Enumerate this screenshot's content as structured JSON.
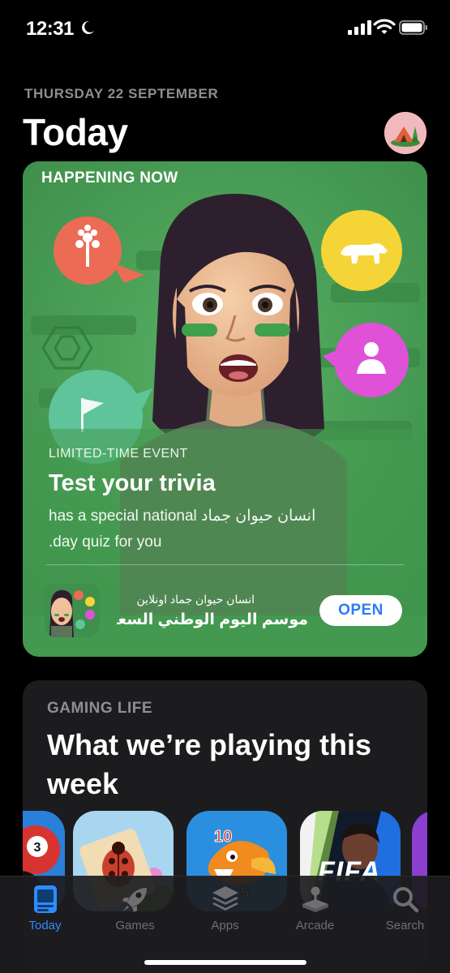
{
  "status_bar": {
    "time": "12:31"
  },
  "header": {
    "date": "THURSDAY 22 SEPTEMBER",
    "title": "Today"
  },
  "featured": {
    "kicker": "HAPPENING NOW",
    "event_kicker": "LIMITED-TIME EVENT",
    "event_title": "Test your trivia",
    "event_desc_line1": "انسان حيوان جماد has a special national",
    "event_desc_line2": "day quiz for you.",
    "app_subtitle": "انسان حيوان جماد اونلاين",
    "app_name": "موسم اليوم الوطني السعودي",
    "open_label": "OPEN",
    "accent": "#43994f"
  },
  "gaming": {
    "kicker": "GAMING LIFE",
    "title": "What we’re playing this week",
    "game_icons": [
      "8-ball-icon",
      "ladybug-icon",
      "fish-game-icon",
      "fifa-icon",
      "purple-game-icon"
    ],
    "fifa_text": "FIFA"
  },
  "tabbar": {
    "tabs": [
      {
        "label": "Today",
        "icon": "today-icon",
        "active": true
      },
      {
        "label": "Games",
        "icon": "rocket-icon",
        "active": false
      },
      {
        "label": "Apps",
        "icon": "apps-stack-icon",
        "active": false
      },
      {
        "label": "Arcade",
        "icon": "joystick-icon",
        "active": false
      },
      {
        "label": "Search",
        "icon": "search-icon",
        "active": false
      }
    ],
    "active_color": "#2d8cff"
  }
}
